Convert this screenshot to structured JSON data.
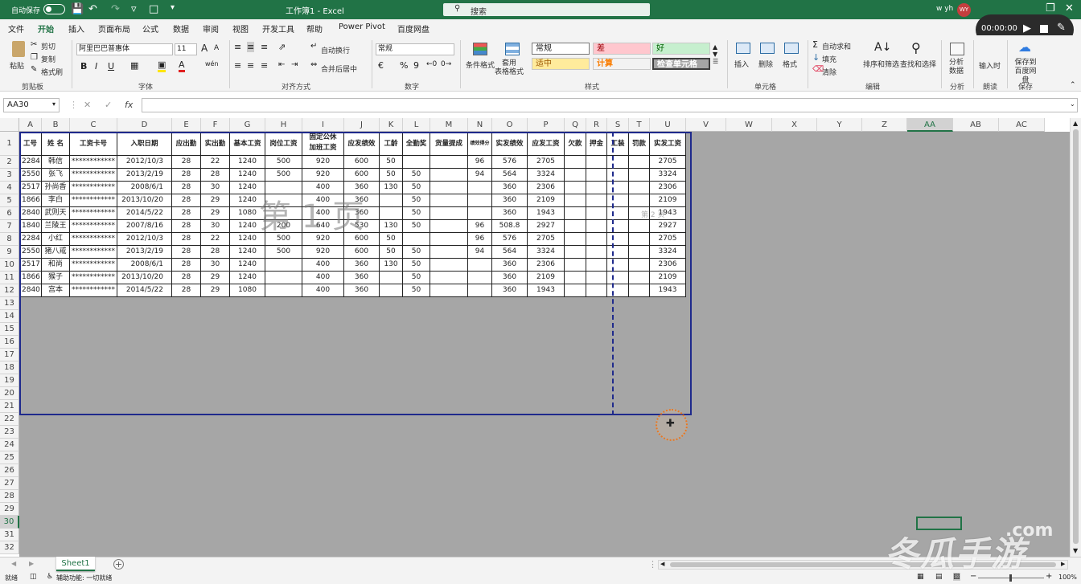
{
  "titlebar": {
    "autosave_label": "自动保存",
    "autosave_state": "关",
    "document_title": "工作簿1 - Excel",
    "search_placeholder": "搜索",
    "user_name": "w yh",
    "user_initials": "WY"
  },
  "recorder": {
    "time": "00:00:00"
  },
  "menu": {
    "items": [
      "文件",
      "开始",
      "插入",
      "页面布局",
      "公式",
      "数据",
      "审阅",
      "视图",
      "开发工具",
      "帮助",
      "Power Pivot",
      "百度网盘"
    ],
    "active": "开始"
  },
  "ribbon": {
    "clipboard": {
      "paste": "粘贴",
      "cut": "剪切",
      "copy": "复制",
      "format_painter": "格式刷",
      "title": "剪贴板"
    },
    "font": {
      "name": "阿里巴巴普惠体",
      "size": "11",
      "bold": "B",
      "italic": "I",
      "underline": "U",
      "grow": "A",
      "shrink": "A",
      "color_a": "A",
      "wen": "wén",
      "title": "字体"
    },
    "alignment": {
      "wrap": "自动换行",
      "merge": "合并后居中",
      "title": "对齐方式"
    },
    "number": {
      "format": "常规",
      "percent": "%",
      "comma": "9",
      "title": "数字"
    },
    "styles": {
      "conditional": "条件格式",
      "table": "套用\n表格格式",
      "normal": "常规",
      "bad": "差",
      "good": "好",
      "neutral": "适中",
      "calc": "计算",
      "check": "检查单元格",
      "title": "样式"
    },
    "cells": {
      "insert": "插入",
      "delete": "删除",
      "format": "格式",
      "title": "单元格"
    },
    "editing": {
      "autosum": "自动求和",
      "fill": "填充",
      "clear": "清除",
      "sort": "排序和筛选",
      "find": "查找和选择",
      "title": "编辑"
    },
    "analysis": {
      "analyze": "分析\n数据",
      "title": "分析"
    },
    "read": {
      "read_aloud": "输入时",
      "title": "朗读"
    },
    "save": {
      "baidu": "保存到\n百度网盘",
      "title": "保存"
    }
  },
  "formula_bar": {
    "name_box": "AA30",
    "fx": "fx",
    "cancel": "✕",
    "enter": "✓",
    "content": ""
  },
  "grid": {
    "columns": [
      "A",
      "B",
      "C",
      "D",
      "E",
      "F",
      "G",
      "H",
      "I",
      "J",
      "K",
      "L",
      "M",
      "N",
      "O",
      "P",
      "Q",
      "R",
      "S",
      "T",
      "U",
      "V",
      "W",
      "X",
      "Y",
      "Z",
      "AA",
      "AB",
      "AC"
    ],
    "rows": [
      "1",
      "2",
      "3",
      "4",
      "5",
      "6",
      "7",
      "8",
      "9",
      "10",
      "11",
      "12",
      "13",
      "14",
      "15",
      "16",
      "17",
      "18",
      "19",
      "20",
      "21",
      "22",
      "23",
      "24",
      "25",
      "26",
      "27",
      "28",
      "29",
      "30",
      "31",
      "32"
    ],
    "headers": [
      "工号",
      "姓 名",
      "工资卡号",
      "入职日期",
      "应出勤",
      "实出勤",
      "基本工资",
      "岗位工资",
      "固定公休\n加班工资",
      "应发绩效",
      "工龄",
      "全勤奖",
      "货量提成",
      "绩效得分",
      "实发绩效",
      "应发工资",
      "欠款",
      "押金",
      "工装",
      "罚款",
      "实发工资"
    ],
    "data": [
      [
        "2284",
        "韩信",
        "************",
        "2012/10/3",
        "28",
        "22",
        "1240",
        "500",
        "920",
        "600",
        "50",
        "",
        "",
        "96",
        "576",
        "2705",
        "",
        "",
        "",
        "",
        "2705"
      ],
      [
        "2550",
        "张飞",
        "************",
        "2013/2/19",
        "28",
        "28",
        "1240",
        "500",
        "920",
        "600",
        "50",
        "50",
        "",
        "94",
        "564",
        "3324",
        "",
        "",
        "",
        "",
        "3324"
      ],
      [
        "2517",
        "孙尚香",
        "************",
        "2008/6/1",
        "28",
        "30",
        "1240",
        "",
        "400",
        "360",
        "130",
        "50",
        "",
        "",
        "360",
        "2306",
        "",
        "",
        "",
        "",
        "2306"
      ],
      [
        "1866",
        "李白",
        "************",
        "2013/10/20",
        "28",
        "29",
        "1240",
        "",
        "400",
        "360",
        "",
        "50",
        "",
        "",
        "360",
        "2109",
        "",
        "",
        "",
        "",
        "2109"
      ],
      [
        "2840",
        "武则天",
        "************",
        "2014/5/22",
        "28",
        "29",
        "1080",
        "",
        "400",
        "360",
        "",
        "50",
        "",
        "",
        "360",
        "1943",
        "",
        "",
        "",
        "",
        "1943"
      ],
      [
        "1840",
        "兰陵王",
        "************",
        "2007/8/16",
        "28",
        "30",
        "1240",
        "200",
        "640",
        "530",
        "130",
        "50",
        "",
        "96",
        "508.8",
        "2927",
        "",
        "",
        "",
        "",
        "2927"
      ],
      [
        "2284",
        "小红",
        "************",
        "2012/10/3",
        "28",
        "22",
        "1240",
        "500",
        "920",
        "600",
        "50",
        "",
        "",
        "96",
        "576",
        "2705",
        "",
        "",
        "",
        "",
        "2705"
      ],
      [
        "2550",
        "猪八戒",
        "************",
        "2013/2/19",
        "28",
        "28",
        "1240",
        "500",
        "920",
        "600",
        "50",
        "50",
        "",
        "94",
        "564",
        "3324",
        "",
        "",
        "",
        "",
        "3324"
      ],
      [
        "2517",
        "和尚",
        "************",
        "2008/6/1",
        "28",
        "30",
        "1240",
        "",
        "400",
        "360",
        "130",
        "50",
        "",
        "",
        "360",
        "2306",
        "",
        "",
        "",
        "",
        "2306"
      ],
      [
        "1866",
        "猴子",
        "************",
        "2013/10/20",
        "28",
        "29",
        "1240",
        "",
        "400",
        "360",
        "",
        "50",
        "",
        "",
        "360",
        "2109",
        "",
        "",
        "",
        "",
        "2109"
      ],
      [
        "2840",
        "宫本",
        "************",
        "2014/5/22",
        "28",
        "29",
        "1080",
        "",
        "400",
        "360",
        "",
        "50",
        "",
        "",
        "360",
        "1943",
        "",
        "",
        "",
        "",
        "1943"
      ]
    ],
    "page1_watermark": "第 1 页",
    "page2_watermark": "第 2 页"
  },
  "sheets": {
    "tabs": [
      "Sheet1"
    ],
    "add": "+"
  },
  "status": {
    "ready": "就绪",
    "accessibility": "辅助功能: 一切就绪",
    "zoom": "100%"
  },
  "watermark": {
    "site": "冬瓜手游",
    "domain": ".com"
  },
  "colors": {
    "excel_green": "#217346",
    "page_gray": "#a6a6a6",
    "table_border": "#1f2a8c"
  }
}
